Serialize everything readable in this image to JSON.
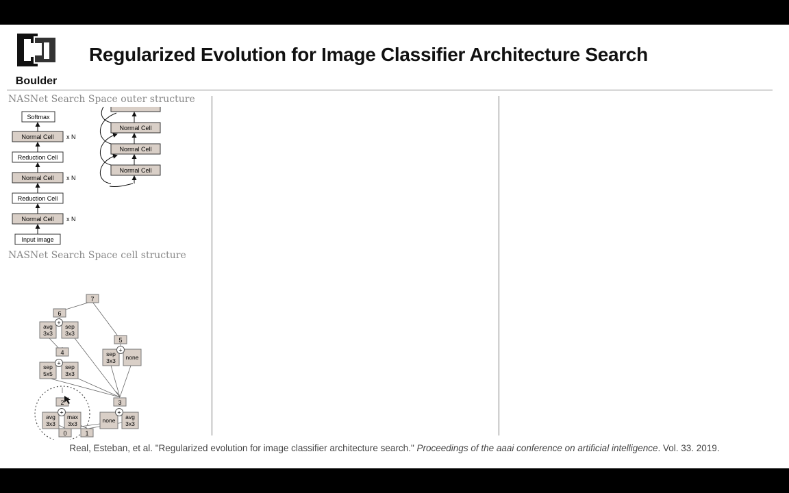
{
  "header": {
    "logo_text": "Boulder",
    "title": "Regularized Evolution for Image Classifier Architecture Search"
  },
  "outer_section": {
    "label": "NASNet Search Space outer structure",
    "stack": [
      "Softmax",
      "Normal Cell",
      "Reduction Cell",
      "Normal Cell",
      "Reduction Cell",
      "Normal Cell",
      "Input image"
    ],
    "repeat_label": "x N",
    "detail_cells": [
      "Normal Cell",
      "Normal Cell",
      "Normal Cell",
      "Normal Cell"
    ]
  },
  "cell_section": {
    "label": "NASNet Search Space cell structure",
    "nodes": {
      "n0": "0",
      "n1": "1",
      "n2": "2",
      "n3": "3",
      "n4": "4",
      "n5": "5",
      "n6": "6",
      "n7": "7"
    },
    "ops": {
      "avg": "avg",
      "sep": "sep",
      "max": "max",
      "none": "none",
      "k3": "3x3",
      "k5": "5x5"
    },
    "plus": "+"
  },
  "citation": {
    "authors": "Real, Esteban, et al. \"Regularized evolution for image classifier architecture search.\"",
    "venue": "Proceedings of the aaai conference on artificial intelligence",
    "rest": ". Vol. 33. 2019."
  },
  "colors": {
    "cell_fill": "#d9cfc7",
    "text": "#111111",
    "label_gray": "#888888"
  }
}
